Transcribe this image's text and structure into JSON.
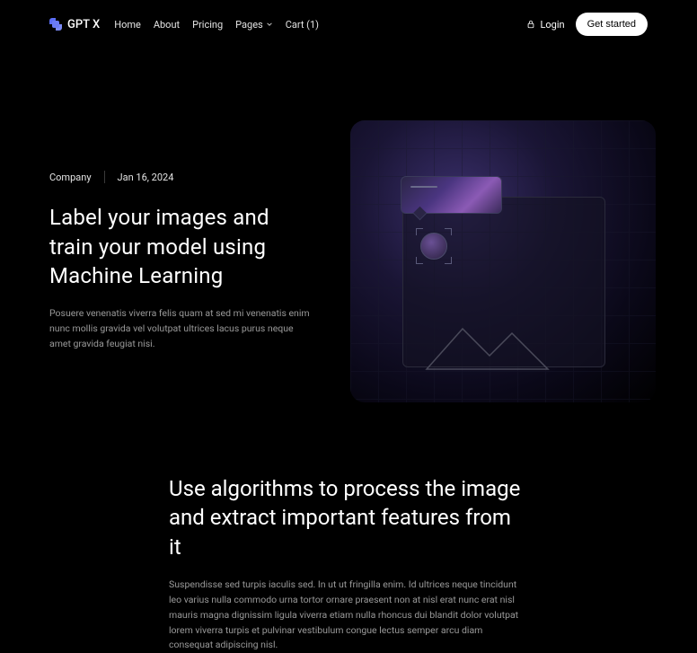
{
  "brand": "GPT X",
  "nav": {
    "home": "Home",
    "about": "About",
    "pricing": "Pricing",
    "pages": "Pages",
    "cart": "Cart (1)"
  },
  "login": "Login",
  "get_started": "Get started",
  "hero": {
    "category": "Company",
    "date": "Jan 16, 2024",
    "title": "Label your images and train your model using Machine Learning",
    "desc": "Posuere venenatis viverra felis quam at sed mi venenatis enim nunc mollis gravida vel volutpat ultrices lacus purus neque amet gravida feugiat nisi."
  },
  "section2": {
    "title": "Use algorithms to process the image and extract important features from it",
    "desc": "Suspendisse sed turpis iaculis sed. In ut ut fringilla enim. Id ultrices neque tincidunt leo varius nulla commodo urna tortor ornare praesent non at nisl erat nunc erat nisl mauris magna dignissim ligula viverra etiam nulla rhoncus dui blandit dolor volutpat lorem viverra turpis et pulvinar vestibulum congue lectus semper arcu diam consequat adipiscing nisl."
  }
}
